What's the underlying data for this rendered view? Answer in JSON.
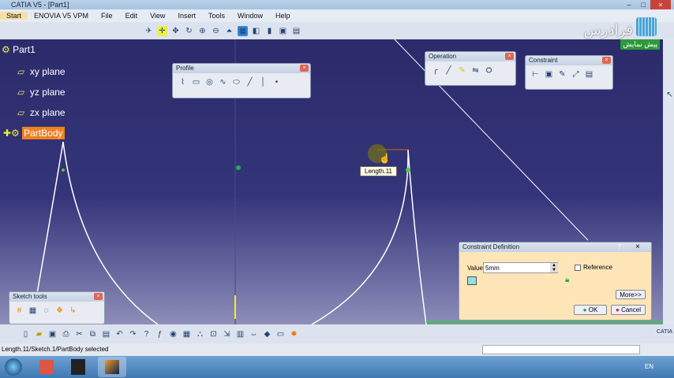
{
  "window": {
    "title": "CATIA V5 - [Part1]"
  },
  "menu": [
    "Start",
    "ENOVIA V5 VPM",
    "File",
    "Edit",
    "View",
    "Insert",
    "Tools",
    "Window",
    "Help"
  ],
  "watermark": {
    "logo": "فرادرس",
    "badge": "پیش نمایش"
  },
  "tree": {
    "root": "Part1",
    "items": [
      "xy plane",
      "yz plane",
      "zx plane"
    ],
    "body": "PartBody"
  },
  "toolbars": {
    "profile": "Profile",
    "operation": "Operation",
    "constraint": "Constraint",
    "sketch_tools": "Sketch tools"
  },
  "tooltip": "Length.11",
  "dialog": {
    "title": "Constraint Definition",
    "help": "?",
    "close": "×",
    "value_label": "Value",
    "value": "5mm",
    "reference_label": "Reference",
    "more": "More>>",
    "ok": "OK",
    "cancel": "Cancel"
  },
  "status": {
    "text": "Length.11/Sketch.1/PartBody selected"
  },
  "brand": "CATIA",
  "taskbar": {
    "lang": "EN"
  }
}
